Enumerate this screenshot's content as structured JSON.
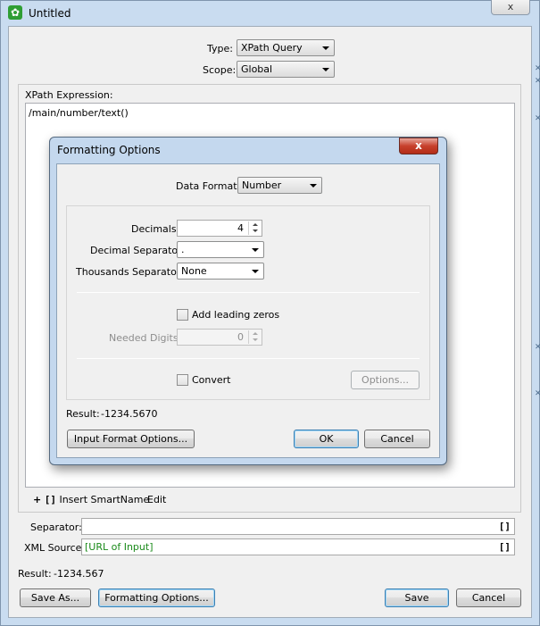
{
  "window": {
    "title": "Untitled",
    "close_glyph": "x",
    "app_icon": "gear-icon"
  },
  "query": {
    "type_label": "Type:",
    "type_value": "XPath Query",
    "scope_label": "Scope:",
    "scope_value": "Global"
  },
  "xpath": {
    "label": "XPath Expression:",
    "expression": "/main/number/text()",
    "insert_smartname_label": "Insert SmartName",
    "insert_smartname_prefix": "+",
    "bracket_glyph": "[]",
    "edit_label": "Edit"
  },
  "separator": {
    "label": "Separator:",
    "value": "",
    "bracket_glyph": "[]"
  },
  "xml_source": {
    "label": "XML Source:",
    "value": "[URL of Input]",
    "value_color": "#1a8a1a",
    "bracket_glyph": "[]"
  },
  "result": {
    "label": "Result:",
    "value": "-1234.567"
  },
  "buttons": {
    "save_as": "Save As...",
    "formatting_options": "Formatting Options...",
    "save": "Save",
    "cancel": "Cancel"
  },
  "dialog": {
    "title": "Formatting Options",
    "close_glyph": "x",
    "data_format_label": "Data Format:",
    "data_format_value": "Number",
    "decimals_label": "Decimals:",
    "decimals_value": "4",
    "decimal_separator_label": "Decimal Separator:",
    "decimal_separator_value": ".",
    "thousands_separator_label": "Thousands Separator:",
    "thousands_separator_value": "None",
    "add_leading_zeros_label": "Add leading zeros",
    "add_leading_zeros_checked": false,
    "needed_digits_label": "Needed Digits:",
    "needed_digits_value": "0",
    "convert_label": "Convert",
    "convert_checked": false,
    "options_button": "Options...",
    "result_label": "Result:",
    "result_value": "-1234.5670",
    "input_format_button": "Input Format Options...",
    "ok_button": "OK",
    "cancel_button": "Cancel"
  }
}
